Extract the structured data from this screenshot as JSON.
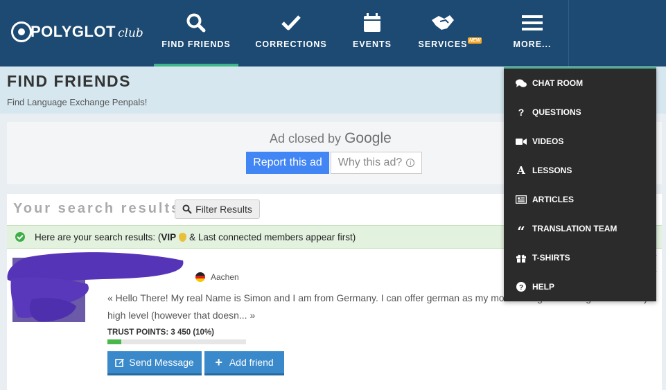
{
  "header": {
    "logo_text": "POLYGLOT",
    "logo_sub": "club",
    "nav": [
      {
        "label": "FIND FRIENDS",
        "icon": "search-icon"
      },
      {
        "label": "CORRECTIONS",
        "icon": "checkmark-icon"
      },
      {
        "label": "EVENTS",
        "icon": "calendar-icon"
      },
      {
        "label": "SERVICES",
        "icon": "handshake-icon",
        "badge": "NEW"
      },
      {
        "label": "MORE...",
        "icon": "hamburger-icon"
      }
    ],
    "active_nav": "FIND FRIENDS"
  },
  "page": {
    "title": "FIND FRIENDS",
    "subtitle": "Find Language Exchange Penpals!"
  },
  "ad": {
    "closed_prefix": "Ad closed by",
    "closed_brand": "Google",
    "report_label": "Report this ad",
    "why_label": "Why this ad?"
  },
  "results": {
    "title": "Your search results",
    "filter_label": "Filter Results",
    "alert_pre": "Here are your search results: (",
    "alert_vip": "VIP",
    "alert_post": "& Last connected members appear first)"
  },
  "member": {
    "city": "Aachen",
    "country_flag": "germany-flag",
    "bio_line1": "« Hello There! My real Name is Simon and I am from Germany. I can offer german as my mother tongue and english on a very",
    "bio_line2": "high level (however that doesn... »",
    "trust_label": "TRUST POINTS: 3 450 (10%)",
    "trust_fraction": 0.1,
    "send_label": "Send Message",
    "add_label": "Add friend"
  },
  "dropdown": {
    "items": [
      {
        "label": "CHAT ROOM",
        "icon": "chat-icon"
      },
      {
        "label": "QUESTIONS",
        "icon": "question-icon"
      },
      {
        "label": "VIDEOS",
        "icon": "video-camera-icon"
      },
      {
        "label": "LESSONS",
        "icon": "letter-a-icon"
      },
      {
        "label": "ARTICLES",
        "icon": "newspaper-icon"
      },
      {
        "label": "TRANSLATION TEAM",
        "icon": "quote-icon"
      },
      {
        "label": "T-SHIRTS",
        "icon": "gift-icon"
      },
      {
        "label": "HELP",
        "icon": "help-icon"
      }
    ]
  },
  "colors": {
    "nav_bg": "#1d4a73",
    "active_underline": "#3fb58a",
    "header_band": "#d6e7ef",
    "button_blue": "#3a8acb",
    "google_blue": "#4285f4",
    "alert_bg": "#e3f1df",
    "dropdown_bg": "#2b2b2b",
    "trust_fill": "#48b84a"
  }
}
